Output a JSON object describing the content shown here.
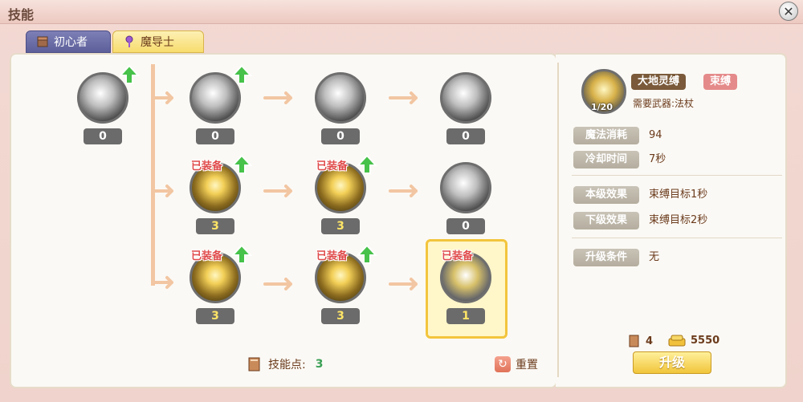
{
  "window": {
    "title": "技能",
    "close_glyph": "✕"
  },
  "tabs": [
    {
      "label": "初心者"
    },
    {
      "label": "魔导士"
    }
  ],
  "tree": {
    "nodes": [
      {
        "id": "n0",
        "level": "0",
        "style": "gray",
        "upgradable": true,
        "equipped": false
      },
      {
        "id": "n1",
        "level": "0",
        "style": "gray",
        "upgradable": true,
        "equipped": false
      },
      {
        "id": "n2",
        "level": "0",
        "style": "gray",
        "upgradable": false,
        "equipped": false
      },
      {
        "id": "n3",
        "level": "0",
        "style": "gray",
        "upgradable": false,
        "equipped": false
      },
      {
        "id": "n4",
        "level": "3",
        "style": "gold",
        "upgradable": true,
        "equipped": true
      },
      {
        "id": "n5",
        "level": "3",
        "style": "gold",
        "upgradable": true,
        "equipped": true
      },
      {
        "id": "n6",
        "level": "0",
        "style": "gray",
        "upgradable": false,
        "equipped": false
      },
      {
        "id": "n7",
        "level": "3",
        "style": "gold",
        "upgradable": true,
        "equipped": true
      },
      {
        "id": "n8",
        "level": "3",
        "style": "gold",
        "upgradable": true,
        "equipped": true
      },
      {
        "id": "n9",
        "level": "1",
        "style": "selected-gold",
        "upgradable": false,
        "equipped": true,
        "selected": true
      }
    ],
    "equipped_label": "已装备"
  },
  "footer_left": {
    "skill_points_label": "技能点:",
    "skill_points_value": "3",
    "reset_label": "重置"
  },
  "detail": {
    "level_badge": "1/20",
    "skill_name": "大地灵缚",
    "skill_tag": "束缚",
    "weapon_req": "需要武器:法杖",
    "rows": [
      {
        "label": "魔法消耗",
        "value": "94"
      },
      {
        "label": "冷却时间",
        "value": "7秒"
      },
      {
        "label": "本级效果",
        "value": "束缚目标1秒"
      },
      {
        "label": "下级效果",
        "value": "束缚目标2秒"
      },
      {
        "label": "升级条件",
        "value": "无"
      }
    ],
    "cost_books": "4",
    "cost_gold": "5550",
    "upgrade_label": "升级"
  }
}
